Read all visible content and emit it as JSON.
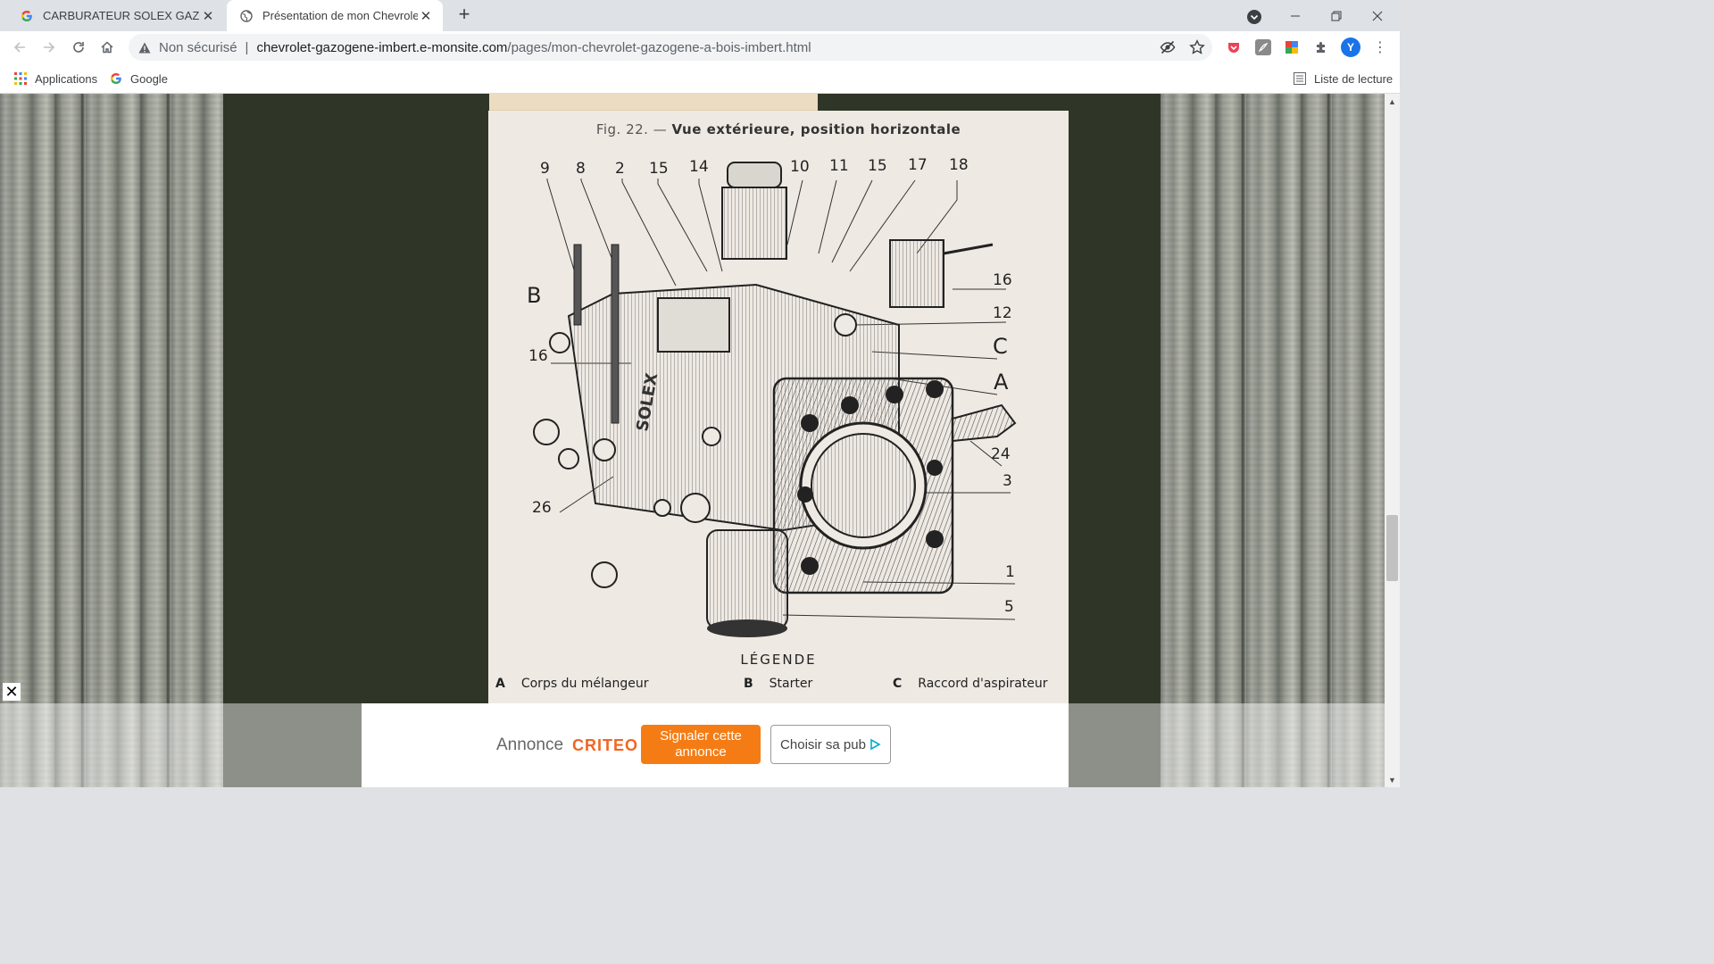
{
  "tabs": [
    {
      "title": "CARBURATEUR SOLEX GAZOGEN",
      "favicon": "google-icon",
      "active": false
    },
    {
      "title": "Présentation de mon Chevrolet G",
      "favicon": "globe-icon",
      "active": true
    }
  ],
  "toolbar": {
    "security_label": "Non sécurisé",
    "url_host": "chevrolet-gazogene-imbert.e-monsite.com",
    "url_path": "/pages/mon-chevrolet-gazogene-a-bois-imbert.html",
    "profile_initial": "Y"
  },
  "bookmarks": {
    "items": [
      {
        "label": "Applications",
        "icon": "apps-grid-icon"
      },
      {
        "label": "Google",
        "icon": "google-icon"
      }
    ],
    "reading_list": "Liste de lecture"
  },
  "figure": {
    "caption_prefix": "Fig. 22. —",
    "caption_title": "Vue extérieure, position horizontale",
    "top_numbers": [
      "9",
      "8",
      "2",
      "15",
      "14",
      "10",
      "11",
      "15",
      "17",
      "18"
    ],
    "right_numbers": [
      "16",
      "12",
      "24",
      "3",
      "1",
      "5"
    ],
    "right_letters": [
      "C",
      "A"
    ],
    "left_letter": "B",
    "left_numbers": [
      "16",
      "26"
    ],
    "legend_title": "LÉGENDE",
    "legend": [
      {
        "key": "A",
        "text": "Corps du mélangeur"
      },
      {
        "key": "B",
        "text": "Starter"
      },
      {
        "key": "C",
        "text": "Raccord d'aspirateur"
      }
    ]
  },
  "ad": {
    "label": "Annonce",
    "brand": "CRITEO",
    "report_button": "Signaler cette annonce",
    "choose_button": "Choisir sa pub"
  },
  "colors": {
    "page_background": "#2f3628",
    "ad_report": "#f57c14",
    "criteo": "#f26522"
  }
}
